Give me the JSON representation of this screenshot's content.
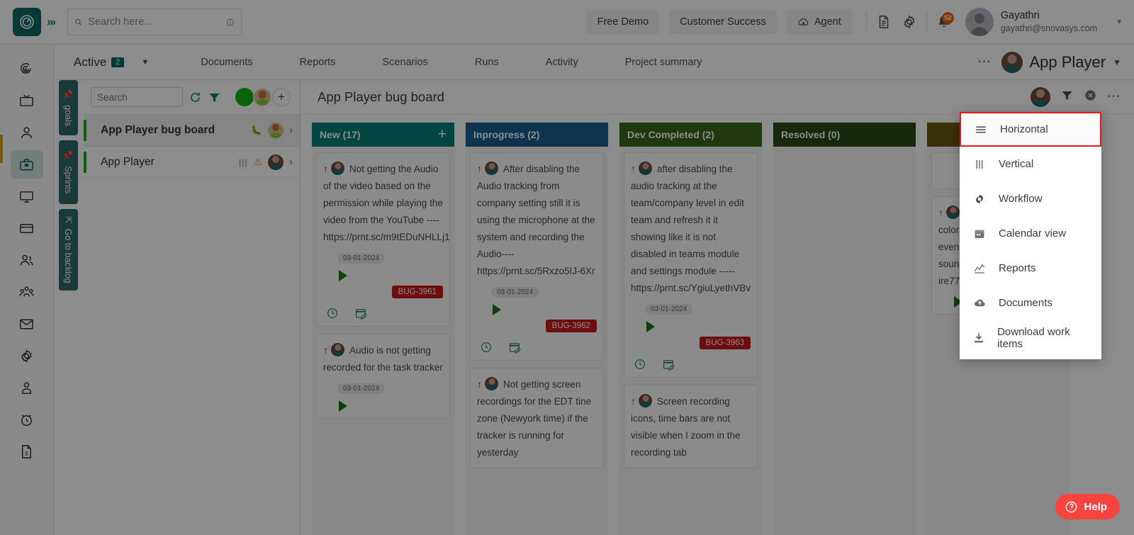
{
  "topbar": {
    "logo_icon": "clock-target-logo-icon",
    "expand_icon": "chevrons-right-icon",
    "search": {
      "placeholder": "Search here...",
      "value": "",
      "icon": "search-icon",
      "info_icon": "info-circle-icon"
    },
    "buttons": [
      {
        "label": "Free Demo",
        "name": "free-demo-button"
      },
      {
        "label": "Customer Success",
        "name": "customer-success-button"
      },
      {
        "label": "Agent",
        "name": "agent-button",
        "icon": "cloud-download-icon"
      }
    ],
    "icons": [
      {
        "name": "document-icon"
      },
      {
        "name": "gear-icon"
      },
      {
        "name": "bell-icon",
        "badge": "52"
      }
    ],
    "user": {
      "name": "Gayathri",
      "email": "gayathri@snovasys.com",
      "avatar": "user-avatar",
      "caret": "chevron-down-icon"
    }
  },
  "rail": {
    "items": [
      {
        "name": "sidebar-item-target",
        "icon": "target-spiral-icon"
      },
      {
        "name": "sidebar-item-tv",
        "icon": "tv-icon"
      },
      {
        "name": "sidebar-item-user",
        "icon": "person-icon"
      },
      {
        "name": "sidebar-item-projects",
        "icon": "briefcase-icon",
        "active": true
      },
      {
        "name": "sidebar-item-monitor",
        "icon": "monitor-icon"
      },
      {
        "name": "sidebar-item-card",
        "icon": "credit-card-icon"
      },
      {
        "name": "sidebar-item-people",
        "icon": "people-icon"
      },
      {
        "name": "sidebar-item-teams",
        "icon": "team-group-icon"
      },
      {
        "name": "sidebar-item-mail",
        "icon": "mail-icon"
      },
      {
        "name": "sidebar-item-settings",
        "icon": "gear-icon"
      },
      {
        "name": "sidebar-item-profile",
        "icon": "user-badge-icon"
      },
      {
        "name": "sidebar-item-timer",
        "icon": "alarm-clock-icon"
      },
      {
        "name": "sidebar-item-invoice",
        "icon": "invoice-icon"
      }
    ]
  },
  "navrow": {
    "active_label": "Active",
    "active_count": "2",
    "caret_icon": "caret-down-icon",
    "tabs": [
      {
        "label": "Documents",
        "name": "tab-documents"
      },
      {
        "label": "Reports",
        "name": "tab-reports"
      },
      {
        "label": "Scenarios",
        "name": "tab-scenarios"
      },
      {
        "label": "Runs",
        "name": "tab-runs"
      },
      {
        "label": "Activity",
        "name": "tab-activity"
      },
      {
        "label": "Project summary",
        "name": "tab-project-summary"
      }
    ],
    "more_icon": "ellipsis-icon",
    "project_name": "App Player",
    "project_caret": "chevron-down-icon"
  },
  "vtabs": [
    {
      "label": "goals",
      "icon": "pin-icon",
      "name": "vtab-goals"
    },
    {
      "label": "Sprints",
      "icon": "pin-icon",
      "name": "vtab-sprints"
    },
    {
      "label": "Go to backlog",
      "icon": "arrow-up-icon",
      "name": "vtab-go-to-backlog"
    }
  ],
  "project_panel": {
    "search": {
      "placeholder": "Search",
      "value": ""
    },
    "refresh_icon": "refresh-icon",
    "filter_icon": "filter-icon",
    "add_icon": "plus-icon",
    "rows": [
      {
        "title": "App Player bug board",
        "name": "list-item-app-player-bug-board",
        "selected": true,
        "bug_icon": "bug-icon",
        "chevron": "chevron-right-icon"
      },
      {
        "title": "App Player",
        "name": "list-item-app-player",
        "selected": false,
        "vertical_icon": "vertical-bars-icon",
        "warn_icon": "warning-icon",
        "chevron": "chevron-right-icon"
      }
    ]
  },
  "board": {
    "title": "App Player bug board",
    "header_icons": [
      {
        "name": "board-avatar",
        "icon": "user-avatar"
      },
      {
        "name": "filter-icon",
        "icon": "filter-icon"
      },
      {
        "name": "clear-filter-icon",
        "icon": "close-circle-icon"
      },
      {
        "name": "board-more-icon",
        "icon": "ellipsis-icon"
      }
    ],
    "columns": [
      {
        "name": "column-new",
        "title": "New (17)",
        "color": "#00807b",
        "has_add": true,
        "add_icon": "plus-icon",
        "cards": [
          {
            "text": "Not getting the Audio of the video based on the permission while playing the video from the YouTube ---- https://prnt.sc/m9tEDuNHLLj1",
            "date": "03-01-2024",
            "tag": "BUG-3961",
            "priority_icon": "arrow-up-priority-icon",
            "play_icon": "play-icon",
            "foot_icons": [
              "clock-icon",
              "calendar-edit-icon"
            ]
          },
          {
            "text": "Audio is not getting recorded for the task tracker",
            "date": "03-01-2024",
            "tag": "",
            "priority_icon": "arrow-up-priority-icon",
            "play_icon": "play-icon",
            "foot_icons": []
          }
        ]
      },
      {
        "name": "column-inprogress",
        "title": "Inprogress (2)",
        "color": "#17608f",
        "has_add": false,
        "cards": [
          {
            "text": "After disabling the Audio tracking from company setting still it is using the microphone at the system and recording the Audio---- https://prnt.sc/5Rxzo5IJ-6Xr",
            "date": "03-01-2024",
            "tag": "BUG-3962",
            "priority_icon": "arrow-up-priority-icon",
            "play_icon": "play-icon",
            "foot_icons": [
              "clock-icon",
              "calendar-edit-icon"
            ]
          },
          {
            "text": "Not getting screen recordings for the EDT tine zone (Newyork time) if the tracker is running for yesterday",
            "date": "",
            "tag": "",
            "priority_icon": "arrow-up-priority-icon",
            "play_icon": "",
            "foot_icons": []
          }
        ]
      },
      {
        "name": "column-dev-completed",
        "title": "Dev Completed (2)",
        "color": "#3a6618",
        "has_add": false,
        "cards": [
          {
            "text": "after disabling the audio tracking at the team/company level in edit team and refresh it it showing like it is not disabled in teams module and settings module ----- https://prnt.sc/YgiuLyethVBv",
            "date": "03-01-2024",
            "tag": "BUG-3963",
            "priority_icon": "arrow-up-priority-icon",
            "play_icon": "play-icon",
            "foot_icons": [
              "clock-icon",
              "calendar-edit-icon"
            ]
          },
          {
            "text": "Screen recording icons, time bars are not visible when I zoom in the recording tab",
            "date": "",
            "tag": "",
            "priority_icon": "arrow-up-priority-icon",
            "play_icon": "",
            "foot_icons": []
          }
        ]
      },
      {
        "name": "column-resolved",
        "title": "Resolved (0)",
        "color": "#2c4a14",
        "has_add": false,
        "cards": []
      },
      {
        "name": "column-partial",
        "title": "",
        "color": "#6b5a10",
        "has_add": false,
        "cards": [
          {
            "text": "Showing the same color for the Sound bar even though I decrease the sound-- https://prnt.sc/YUa-ire77tRC",
            "date": "",
            "tag": "",
            "priority_icon": "arrow-up-priority-icon",
            "play_icon": "play-icon",
            "foot_icons": []
          }
        ]
      }
    ]
  },
  "context_menu": {
    "items": [
      {
        "label": "Horizontal",
        "icon": "horizontal-lines-icon",
        "name": "menu-item-horizontal",
        "highlighted": true
      },
      {
        "label": "Vertical",
        "icon": "vertical-bars-icon",
        "name": "menu-item-vertical",
        "highlighted": false
      },
      {
        "label": "Workflow",
        "icon": "gear-icon",
        "name": "menu-item-workflow",
        "highlighted": false
      },
      {
        "label": "Calendar view",
        "icon": "calendar-icon",
        "name": "menu-item-calendar-view",
        "highlighted": false
      },
      {
        "label": "Reports",
        "icon": "chart-line-icon",
        "name": "menu-item-reports",
        "highlighted": false
      },
      {
        "label": "Documents",
        "icon": "cloud-upload-icon",
        "name": "menu-item-documents",
        "highlighted": false
      },
      {
        "label": "Download work items",
        "icon": "download-icon",
        "name": "menu-item-download-work-items",
        "highlighted": false
      }
    ]
  },
  "help": {
    "label": "Help",
    "icon": "question-circle-icon"
  },
  "colors": {
    "brand": "#0b6b64",
    "highlight_border": "#f11616",
    "bug_tag": "#c9191b",
    "help": "#f8443f"
  }
}
